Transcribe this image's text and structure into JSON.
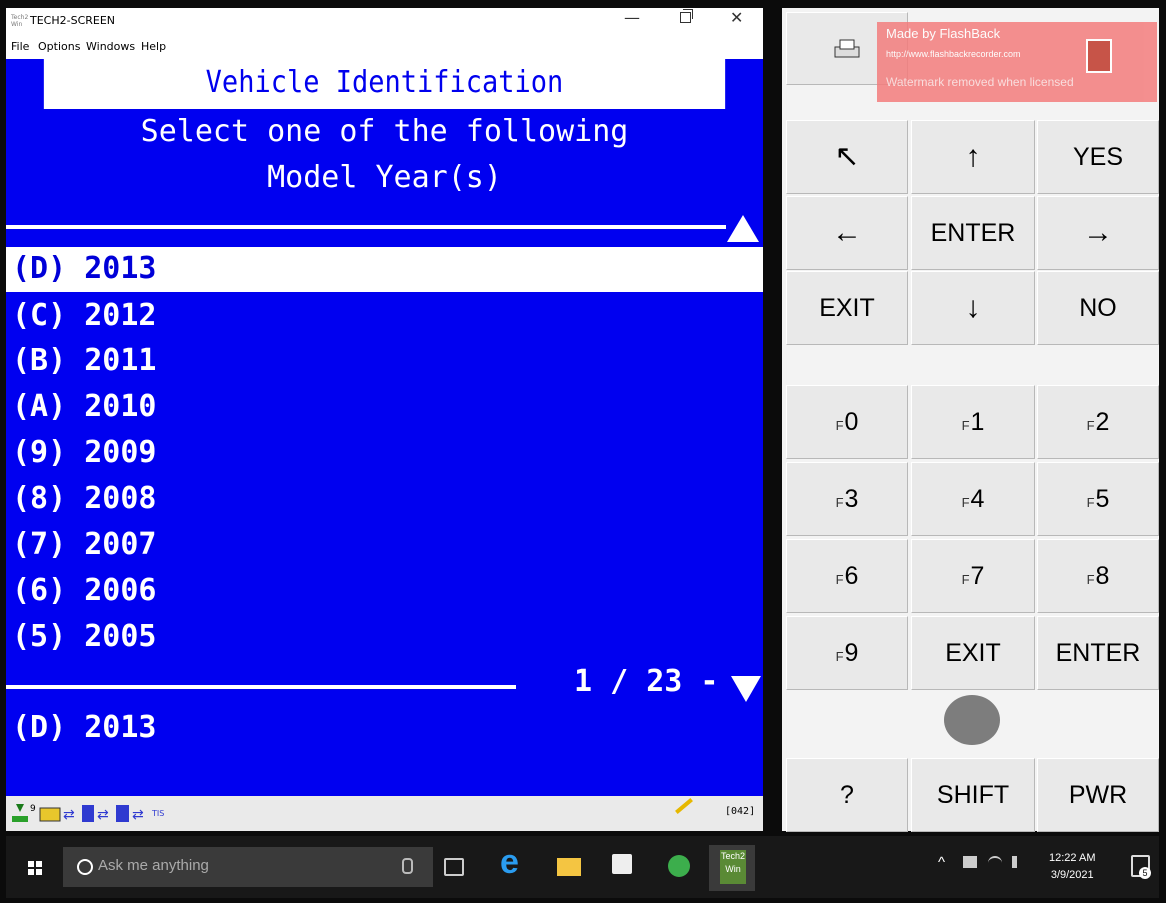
{
  "window": {
    "app_logo_text": "Tech2 Win",
    "title": "TECH2-SCREEN",
    "minimize_glyph": "—",
    "close_glyph": "✕",
    "menu": [
      "File",
      "Options",
      "Windows",
      "Help"
    ]
  },
  "screen": {
    "title": "Vehicle Identification",
    "prompt_line1": "Select one of the following",
    "prompt_line2": "Model Year(s)",
    "items": [
      "(D) 2013",
      "(C) 2012",
      "(B) 2011",
      "(A) 2010",
      "(9) 2009",
      "(8) 2008",
      "(7) 2007",
      "(6) 2006",
      "(5) 2005"
    ],
    "selected_index": 0,
    "page_indicator": "1 / 23 -",
    "selection_echo": "(D) 2013"
  },
  "status_bar": {
    "code": "[042]",
    "icons": [
      "battery-level-icon",
      "bus-icon",
      "transfer-icon",
      "tool-icon",
      "transfer-icon",
      "connector-icon",
      "transfer-icon",
      "tis-icon"
    ],
    "battery_label": "9",
    "tis_label": "TIS"
  },
  "keypad": {
    "print_icon": "printer-icon",
    "rows": [
      [
        {
          "label": "↖",
          "arrow": true
        },
        {
          "label": "↑",
          "arrow": true
        },
        {
          "label": "YES"
        }
      ],
      [
        {
          "label": "←",
          "arrow": true
        },
        {
          "label": "ENTER"
        },
        {
          "label": "→",
          "arrow": true
        }
      ],
      [
        {
          "label": "EXIT"
        },
        {
          "label": "↓",
          "arrow": true
        },
        {
          "label": "NO"
        }
      ]
    ],
    "fkeys": [
      [
        {
          "f": "F",
          "n": "0"
        },
        {
          "f": "F",
          "n": "1"
        },
        {
          "f": "F",
          "n": "2"
        }
      ],
      [
        {
          "f": "F",
          "n": "3"
        },
        {
          "f": "F",
          "n": "4"
        },
        {
          "f": "F",
          "n": "5"
        }
      ],
      [
        {
          "f": "F",
          "n": "6"
        },
        {
          "f": "F",
          "n": "7"
        },
        {
          "f": "F",
          "n": "8"
        }
      ]
    ],
    "f9": {
      "f": "F",
      "n": "9"
    },
    "exit2": "EXIT",
    "enter2": "ENTER",
    "help": "?",
    "shift": "SHIFT",
    "power": "PWR"
  },
  "watermark": {
    "line1": "Made by FlashBack",
    "line2": "http://www.flashbackrecorder.com",
    "line3": "Watermark removed when licensed"
  },
  "taskbar": {
    "search_placeholder": "Ask me anything",
    "tech2_label_1": "Tech2",
    "tech2_label_2": "Win",
    "time": "12:22 AM",
    "date": "3/9/2021",
    "notification_count": "5"
  }
}
